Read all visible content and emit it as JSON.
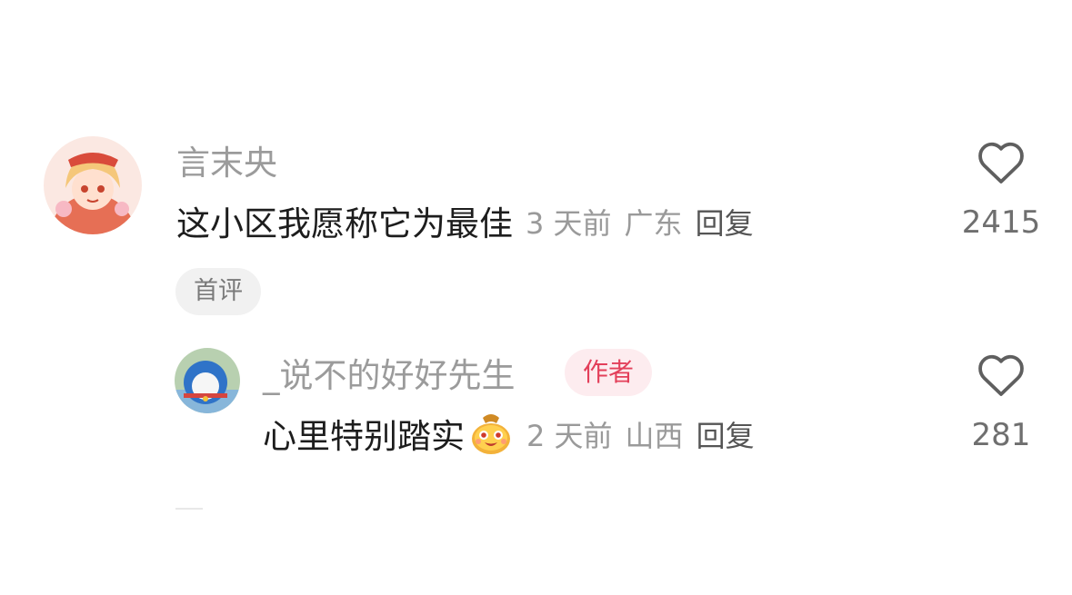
{
  "comment": {
    "username": "言末央",
    "text": "这小区我愿称它为最佳",
    "time": "3 天前",
    "location": "广东",
    "reply_label": "回复",
    "like_count": "2415",
    "badge": "首评"
  },
  "reply": {
    "username": "_说不的好好先生",
    "author_badge": "作者",
    "text": "心里特别踏实",
    "time": "2 天前",
    "location": "山西",
    "reply_label": "回复",
    "like_count": "281"
  },
  "icons": {
    "like": "heart-outline-icon",
    "emoji": "smiling-face-emoji"
  },
  "colors": {
    "author_badge_bg": "#fdecef",
    "author_badge_text": "#e33f5a",
    "first_badge_bg": "#f1f1f1"
  }
}
